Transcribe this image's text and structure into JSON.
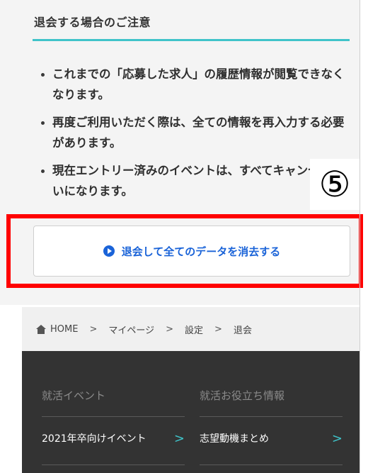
{
  "section": {
    "title": "退会する場合のご注意",
    "notes": [
      "これまでの「応募した求人」の履歴情報が閲覧できなくなります。",
      "再度ご利用いただく際は、全ての情報を再入力する必要があります。",
      "現在エントリー済みのイベントは、すべてキャンセル扱いになります。"
    ]
  },
  "annotation": {
    "marker": "⑤"
  },
  "action": {
    "delete_label": "退会して全てのデータを消去する"
  },
  "breadcrumb": {
    "items": [
      "HOME",
      "マイページ",
      "設定",
      "退会"
    ],
    "separator": ">"
  },
  "footer": {
    "col1": {
      "heading": "就活イベント",
      "link": "2021年卒向けイベント"
    },
    "col2": {
      "heading": "就活お役立ち情報",
      "link": "志望動機まとめ"
    },
    "chevron": ">"
  },
  "colors": {
    "accent": "#3fc3c9",
    "link_blue": "#1a63d8",
    "highlight_red": "#ff0000",
    "footer_bg": "#333333"
  }
}
